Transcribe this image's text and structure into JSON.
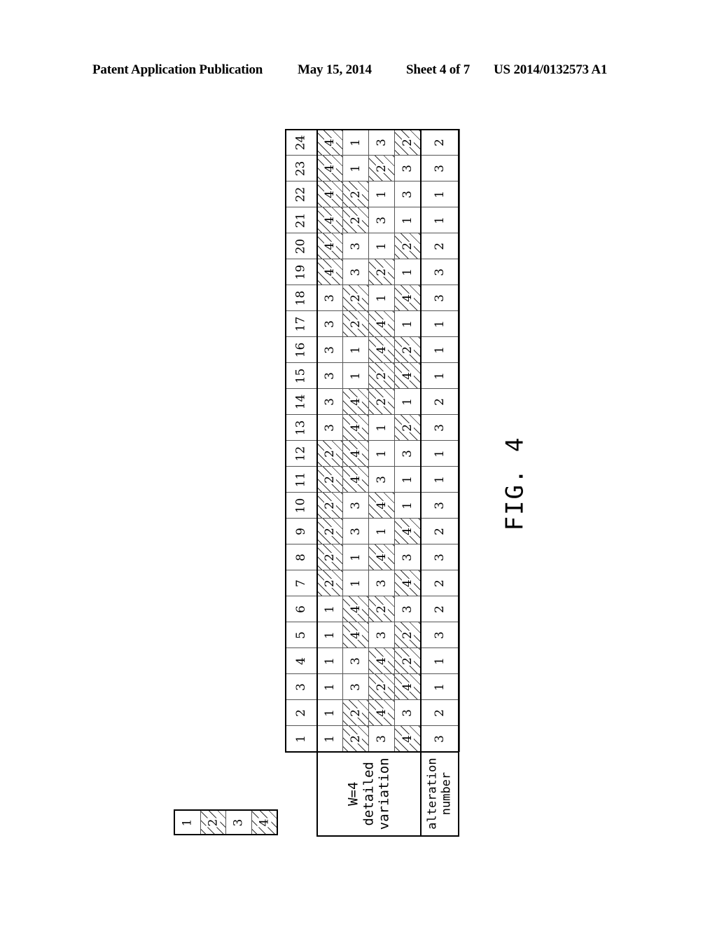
{
  "header": {
    "publication_type": "Patent Application Publication",
    "date": "May 15, 2014",
    "sheet": "Sheet 4 of 7",
    "patent_number": "US 2014/0132573 A1"
  },
  "figure_label": "FIG. 4",
  "legend": {
    "items": [
      {
        "value": "1",
        "hatched": false
      },
      {
        "value": "2",
        "hatched": true
      },
      {
        "value": "3",
        "hatched": false
      },
      {
        "value": "4",
        "hatched": true
      }
    ]
  },
  "table": {
    "row_headers": {
      "variation": [
        "W=4",
        "detailed",
        "variation"
      ],
      "alteration": [
        "alteration",
        "number"
      ]
    },
    "hatched_values": [
      2,
      4
    ],
    "columns": [
      {
        "index": 1,
        "variation": [
          1,
          2,
          3,
          4
        ],
        "alteration": 3
      },
      {
        "index": 2,
        "variation": [
          1,
          2,
          4,
          3
        ],
        "alteration": 2
      },
      {
        "index": 3,
        "variation": [
          1,
          3,
          2,
          4
        ],
        "alteration": 1
      },
      {
        "index": 4,
        "variation": [
          1,
          3,
          4,
          2
        ],
        "alteration": 1
      },
      {
        "index": 5,
        "variation": [
          1,
          4,
          3,
          2
        ],
        "alteration": 3
      },
      {
        "index": 6,
        "variation": [
          1,
          4,
          2,
          3
        ],
        "alteration": 2
      },
      {
        "index": 7,
        "variation": [
          2,
          1,
          3,
          4
        ],
        "alteration": 2
      },
      {
        "index": 8,
        "variation": [
          2,
          1,
          4,
          3
        ],
        "alteration": 3
      },
      {
        "index": 9,
        "variation": [
          2,
          3,
          1,
          4
        ],
        "alteration": 2
      },
      {
        "index": 10,
        "variation": [
          2,
          3,
          4,
          1
        ],
        "alteration": 3
      },
      {
        "index": 11,
        "variation": [
          2,
          4,
          3,
          1
        ],
        "alteration": 1
      },
      {
        "index": 12,
        "variation": [
          2,
          4,
          1,
          3
        ],
        "alteration": 1
      },
      {
        "index": 13,
        "variation": [
          3,
          4,
          1,
          2
        ],
        "alteration": 3
      },
      {
        "index": 14,
        "variation": [
          3,
          4,
          2,
          1
        ],
        "alteration": 2
      },
      {
        "index": 15,
        "variation": [
          3,
          1,
          2,
          4
        ],
        "alteration": 1
      },
      {
        "index": 16,
        "variation": [
          3,
          1,
          4,
          2
        ],
        "alteration": 1
      },
      {
        "index": 17,
        "variation": [
          3,
          2,
          4,
          1
        ],
        "alteration": 1
      },
      {
        "index": 18,
        "variation": [
          3,
          2,
          1,
          4
        ],
        "alteration": 3
      },
      {
        "index": 19,
        "variation": [
          4,
          3,
          2,
          1
        ],
        "alteration": 3
      },
      {
        "index": 20,
        "variation": [
          4,
          3,
          1,
          2
        ],
        "alteration": 2
      },
      {
        "index": 21,
        "variation": [
          4,
          2,
          3,
          1
        ],
        "alteration": 1
      },
      {
        "index": 22,
        "variation": [
          4,
          2,
          1,
          3
        ],
        "alteration": 1
      },
      {
        "index": 23,
        "variation": [
          4,
          1,
          2,
          3
        ],
        "alteration": 3
      },
      {
        "index": 24,
        "variation": [
          4,
          1,
          3,
          2
        ],
        "alteration": 2
      }
    ]
  }
}
